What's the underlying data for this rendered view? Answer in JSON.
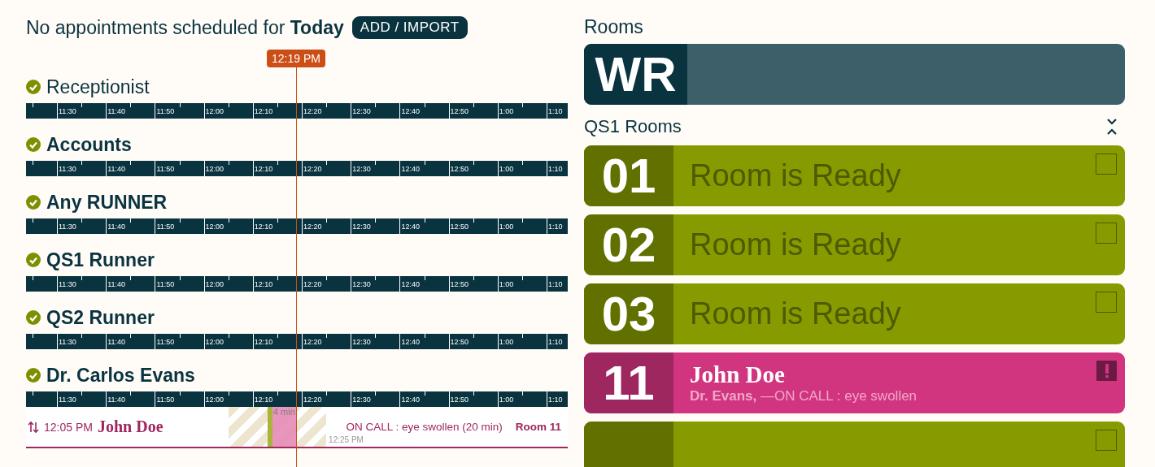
{
  "header": {
    "text": "No appointments scheduled for **Today**",
    "button": "ADD / IMPORT"
  },
  "now_marker": "12:19 PM",
  "staff": [
    {
      "name": "Receptionist",
      "kind": "role",
      "available": true,
      "time_ticks": [
        "11:30",
        "11:40",
        "11:50",
        "12:00",
        "12:10",
        "12:20",
        "12:30",
        "12:40",
        "12:50",
        "1:00",
        "1:10"
      ]
    },
    {
      "name": "Accounts",
      "kind": "person",
      "available": true,
      "time_ticks": [
        "11:30",
        "11:40",
        "11:50",
        "12:00",
        "12:10",
        "12:20",
        "12:30",
        "12:40",
        "12:50",
        "1:00",
        "1:10"
      ]
    },
    {
      "name": "Any RUNNER",
      "kind": "person",
      "available": true,
      "time_ticks": [
        "11:30",
        "11:40",
        "11:50",
        "12:00",
        "12:10",
        "12:20",
        "12:30",
        "12:40",
        "12:50",
        "1:00",
        "1:10"
      ]
    },
    {
      "name": "QS1 Runner",
      "kind": "person",
      "available": true,
      "time_ticks": [
        "11:30",
        "11:40",
        "11:50",
        "12:00",
        "12:10",
        "12:20",
        "12:30",
        "12:40",
        "12:50",
        "1:00",
        "1:10"
      ]
    },
    {
      "name": "QS2 Runner",
      "kind": "person",
      "available": true,
      "time_ticks": [
        "11:30",
        "11:40",
        "11:50",
        "12:00",
        "12:10",
        "12:20",
        "12:30",
        "12:40",
        "12:50",
        "1:00",
        "1:10"
      ]
    },
    {
      "name": "Dr. Carlos Evans",
      "kind": "person",
      "available": true,
      "time_ticks": [
        "11:30",
        "11:40",
        "11:50",
        "12:00",
        "12:10",
        "12:20",
        "12:30",
        "12:40",
        "12:50",
        "1:00",
        "1:10"
      ],
      "appointments": [
        {
          "time": "12:05 PM",
          "patient": "John Doe",
          "wait": "4 min",
          "end_time": "12:25 PM",
          "note": "ON CALL : eye swollen",
          "duration": "(20 min)",
          "room": "Room 11"
        }
      ]
    }
  ],
  "rooms_title": "Rooms",
  "waiting_room": {
    "label": "WR"
  },
  "section": {
    "title": "QS1 Rooms",
    "expanded": true
  },
  "rooms": [
    {
      "number": "01",
      "kind": "ready",
      "status": "Room is Ready",
      "checked": false
    },
    {
      "number": "02",
      "kind": "ready",
      "status": "Room is Ready",
      "checked": false
    },
    {
      "number": "03",
      "kind": "ready",
      "status": "Room is Ready",
      "checked": false
    },
    {
      "number": "11",
      "kind": "occupied",
      "patient": "John Doe",
      "doctor": "Dr. Evans,",
      "note": "—ON CALL : eye swollen",
      "alert": true
    },
    {
      "kind": "ready",
      "checked": false
    }
  ]
}
